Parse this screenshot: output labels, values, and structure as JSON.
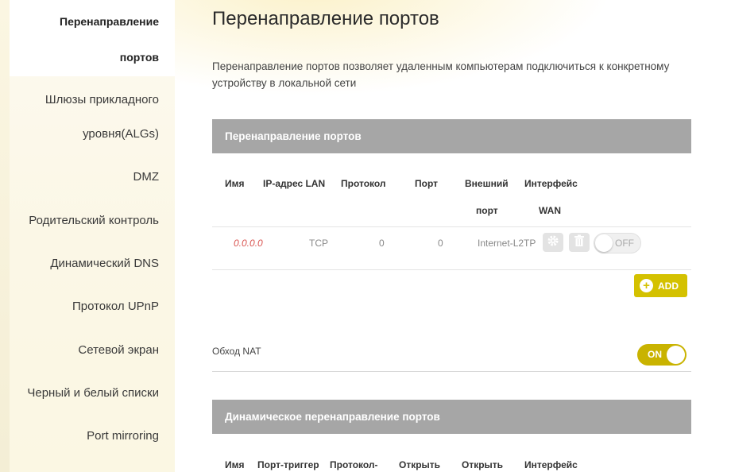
{
  "sidebar": {
    "items": [
      {
        "label_line1": "Перенаправление",
        "label_line2": "портов",
        "active": true
      },
      {
        "label_line1": "Шлюзы прикладного",
        "label_line2": "уровня(ALGs)"
      },
      {
        "label": "DMZ"
      },
      {
        "label": "Родительский контроль"
      },
      {
        "label": "Динамический DNS"
      },
      {
        "label": "Протокол UPnP"
      },
      {
        "label": "Сетевой экран"
      },
      {
        "label": "Черный и белый списки"
      },
      {
        "label": "Port mirroring"
      }
    ]
  },
  "page": {
    "title": "Перенаправление портов",
    "description": "Перенаправление портов позволяет удаленным компьютерам подключиться к конкретному устройству в локальной сети"
  },
  "port_forwarding": {
    "header": "Перенаправление портов",
    "columns": {
      "name": "Имя",
      "ip": "IP-адрес LAN",
      "protocol": "Протокол",
      "port": "Порт",
      "external_port_1": "Внешний",
      "external_port_2": "порт",
      "wan_1": "Интерфейс",
      "wan_2": "WAN"
    },
    "rows": [
      {
        "name": "0.0.0.0",
        "protocol": "TCP",
        "port": "0",
        "external_port": "0",
        "wan": "Internet-L2TP",
        "toggle": "OFF"
      }
    ],
    "add_label": "ADD"
  },
  "nat": {
    "label": "Обход NAT",
    "toggle": "ON"
  },
  "dynamic_forwarding": {
    "header": "Динамическое перенаправление портов",
    "columns": {
      "name": "Имя",
      "trigger": "Порт-триггер",
      "protocol": "Протокол-",
      "open1": "Открыть",
      "open2": "Открыть",
      "iface": "Интерфейс"
    }
  },
  "colors": {
    "accent": "#c9b300",
    "header_bg": "#a6a6a6",
    "error_text": "#d9534f"
  },
  "icons": [
    "gear-icon",
    "trash-icon",
    "plus-icon"
  ]
}
